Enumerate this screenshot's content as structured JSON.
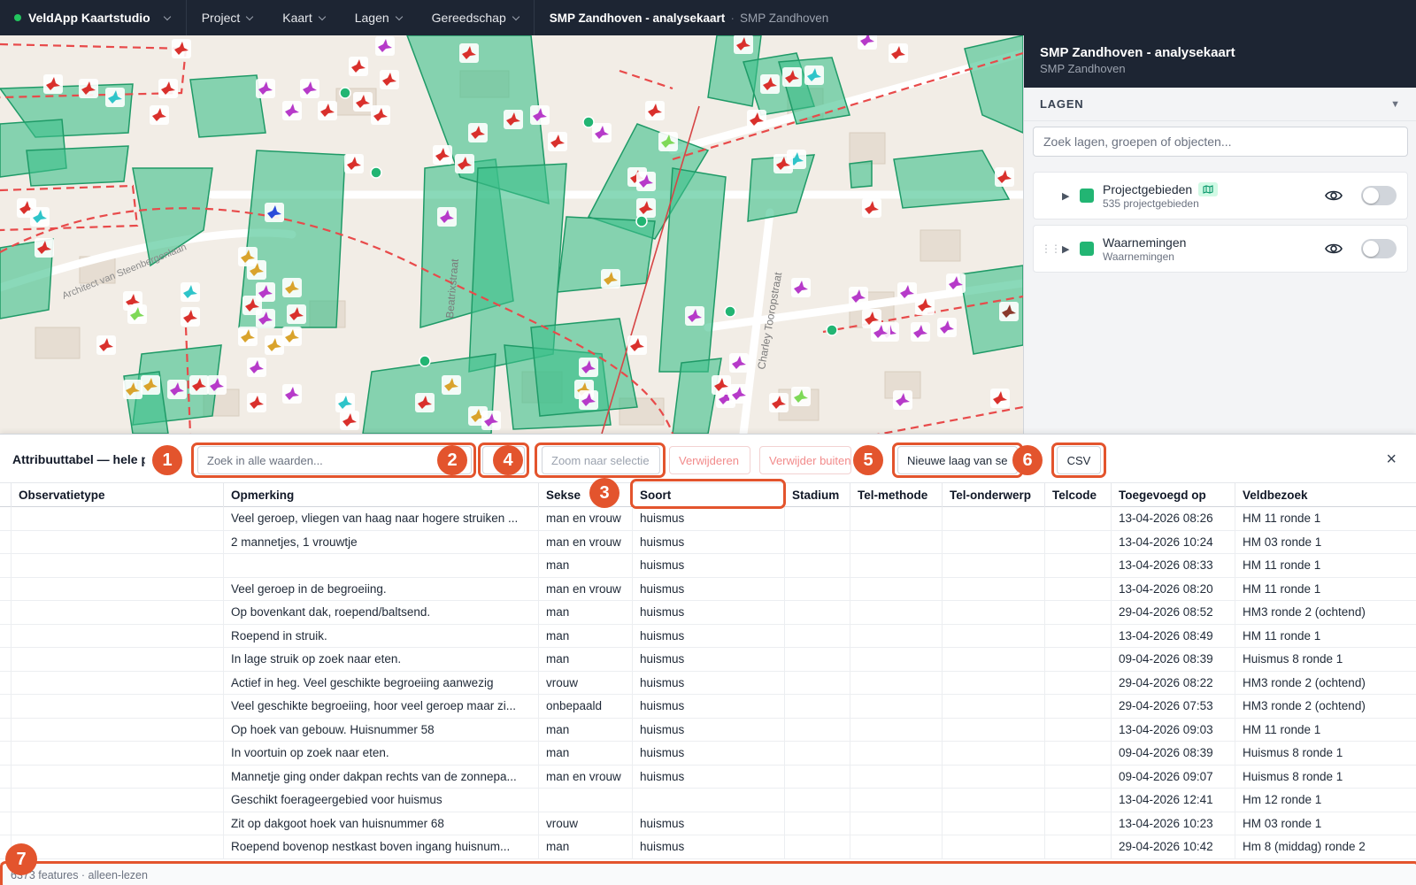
{
  "topbar": {
    "brand": "VeldApp Kaartstudio",
    "menu": [
      "Project",
      "Kaart",
      "Lagen",
      "Gereedschap"
    ],
    "breadcrumb_main": "SMP Zandhoven - analysekaart",
    "breadcrumb_sep": "·",
    "breadcrumb_sub": "SMP Zandhoven"
  },
  "map": {
    "street_labels": [
      "Beatrixstraat",
      "Charley Tooropstraat",
      "Architect van Steenbergenlaan"
    ],
    "colors": {
      "polygon_fill": "#3cbf8a",
      "polygon_stroke": "#1f9a67",
      "boundary": "#e84a4a",
      "background": "#f2ede6"
    }
  },
  "panel": {
    "title": "SMP Zandhoven - analysekaart",
    "subtitle": "SMP Zandhoven",
    "layers_label": "LAGEN",
    "search_placeholder": "Zoek lagen, groepen of objecten...",
    "layers": [
      {
        "name": "Projectgebieden",
        "subtitle": "535 projectgebieden",
        "badge_icon": "map-icon",
        "visible_icon": "eye-icon",
        "enabled": false
      },
      {
        "name": "Waarnemingen",
        "subtitle": "Waarnemingen",
        "visible_icon": "eye-icon",
        "enabled": false
      }
    ]
  },
  "attr": {
    "title": "Attribuuttabel — hele p",
    "search_placeholder": "Zoek in alle waarden...",
    "zoom_label": "Zoom naar selectie",
    "delete_label": "Verwijderen",
    "delete_outside_label": "Verwijder buiten",
    "new_layer_label": "Nieuwe laag van se",
    "csv_label": "CSV",
    "close": "×",
    "callouts": [
      "1",
      "2",
      "3",
      "4",
      "5",
      "6",
      "7"
    ],
    "columns": [
      "Observatietype",
      "Opmerking",
      "Sekse",
      "Soort",
      "Stadium",
      "Tel-methode",
      "Tel-onderwerp",
      "Telcode",
      "Toegevoegd op",
      "Veldbezoek"
    ],
    "rows": [
      [
        "",
        "Veel geroep, vliegen van haag naar hogere struiken ...",
        "man en vrouw",
        "huismus",
        "",
        "",
        "",
        "",
        "13-04-2026 08:26",
        "HM 11 ronde 1"
      ],
      [
        "",
        "2 mannetjes, 1 vrouwtje",
        "man en vrouw",
        "huismus",
        "",
        "",
        "",
        "",
        "13-04-2026 10:24",
        "HM 03 ronde 1"
      ],
      [
        "",
        "",
        "man",
        "huismus",
        "",
        "",
        "",
        "",
        "13-04-2026 08:33",
        "HM 11 ronde 1"
      ],
      [
        "",
        "Veel geroep in de begroeiing.",
        "man en vrouw",
        "huismus",
        "",
        "",
        "",
        "",
        "13-04-2026 08:20",
        "HM 11 ronde 1"
      ],
      [
        "",
        "Op bovenkant dak, roepend/baltsend.",
        "man",
        "huismus",
        "",
        "",
        "",
        "",
        "29-04-2026 08:52",
        "HM3 ronde 2 (ochtend)"
      ],
      [
        "",
        "Roepend in struik.",
        "man",
        "huismus",
        "",
        "",
        "",
        "",
        "13-04-2026 08:49",
        "HM 11 ronde 1"
      ],
      [
        "",
        "In lage struik op zoek naar eten.",
        "man",
        "huismus",
        "",
        "",
        "",
        "",
        "09-04-2026 08:39",
        "Huismus 8 ronde 1"
      ],
      [
        "",
        "Actief in heg. Veel geschikte begroeiing aanwezig",
        "vrouw",
        "huismus",
        "",
        "",
        "",
        "",
        "29-04-2026 08:22",
        "HM3 ronde 2 (ochtend)"
      ],
      [
        "",
        "Veel geschikte begroeiing, hoor veel geroep maar zi...",
        "onbepaald",
        "huismus",
        "",
        "",
        "",
        "",
        "29-04-2026 07:53",
        "HM3 ronde 2 (ochtend)"
      ],
      [
        "",
        "Op hoek van gebouw. Huisnummer 58",
        "man",
        "huismus",
        "",
        "",
        "",
        "",
        "13-04-2026 09:03",
        "HM 11 ronde 1"
      ],
      [
        "",
        "In voortuin op zoek naar eten.",
        "man",
        "huismus",
        "",
        "",
        "",
        "",
        "09-04-2026 08:39",
        "Huismus 8 ronde 1"
      ],
      [
        "",
        "Mannetje ging onder dakpan rechts van de zonnepa...",
        "man en vrouw",
        "huismus",
        "",
        "",
        "",
        "",
        "09-04-2026 09:07",
        "Huismus 8 ronde 1"
      ],
      [
        "",
        "Geschikt foerageergebied voor huismus",
        "",
        "",
        "",
        "",
        "",
        "",
        "13-04-2026 12:41",
        "Hm 12 ronde 1"
      ],
      [
        "",
        "Zit op dakgoot hoek van huisnummer 68",
        "vrouw",
        "huismus",
        "",
        "",
        "",
        "",
        "13-04-2026 10:23",
        "HM 03 ronde 1"
      ],
      [
        "",
        "Roepend bovenop nestkast boven ingang huisnum...",
        "man",
        "huismus",
        "",
        "",
        "",
        "",
        "29-04-2026 10:42",
        "Hm 8 (middag) ronde 2"
      ]
    ],
    "status": "6373 features · alleen-lezen"
  }
}
